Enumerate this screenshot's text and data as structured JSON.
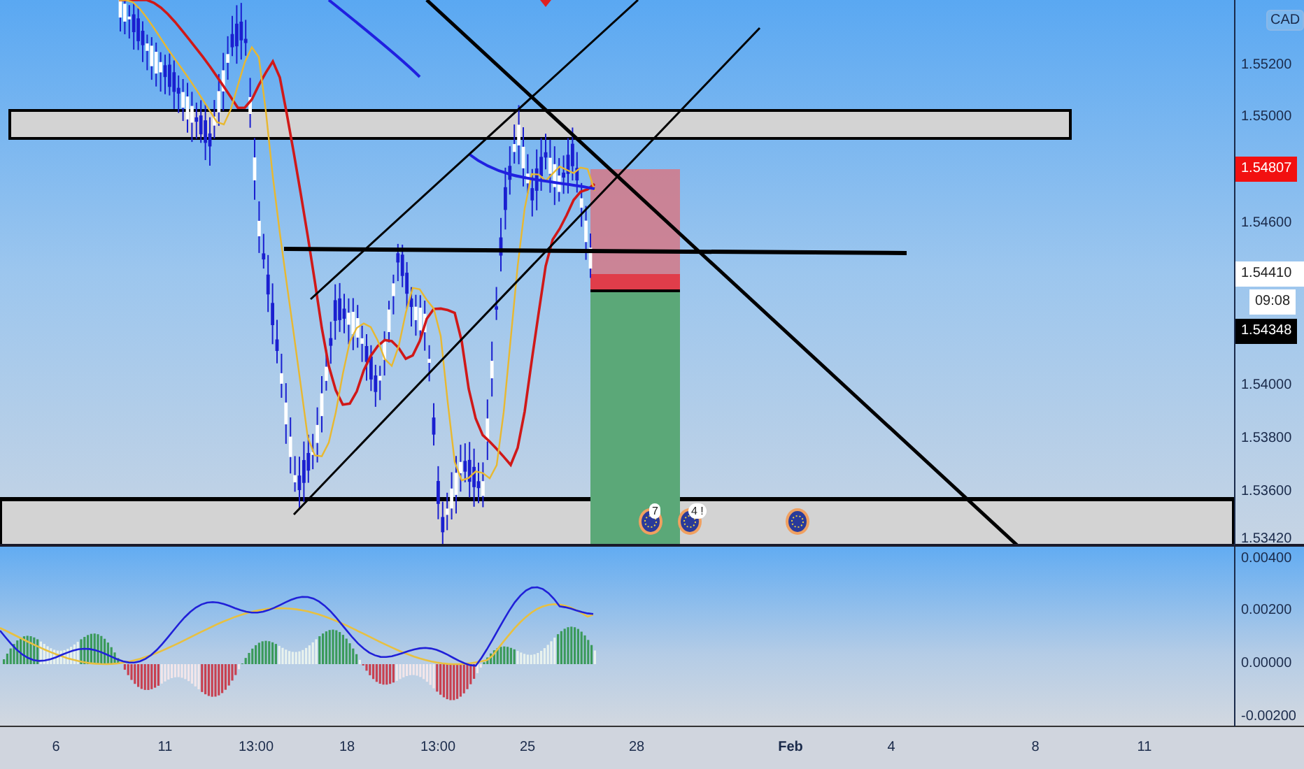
{
  "price_scale": {
    "currency": "CAD",
    "ticks": [
      "1.55200",
      "1.55000",
      "1.54600",
      "1.54000",
      "1.53800",
      "1.53600",
      "1.53420"
    ]
  },
  "price_labels": [
    {
      "kind": "alert",
      "text": "1.54807"
    },
    {
      "kind": "last",
      "text": "1.54410"
    },
    {
      "kind": "countdown",
      "text": "09:08"
    },
    {
      "kind": "cursor",
      "text": "1.54348"
    }
  ],
  "macd_scale": {
    "ticks": [
      "0.00400",
      "0.00200",
      "0.00000",
      "-0.00200"
    ]
  },
  "time_scale": {
    "ticks": [
      {
        "label": "6",
        "major": false
      },
      {
        "label": "11",
        "major": false
      },
      {
        "label": "13:00",
        "major": false
      },
      {
        "label": "18",
        "major": false
      },
      {
        "label": "13:00",
        "major": false
      },
      {
        "label": "25",
        "major": false
      },
      {
        "label": "28",
        "major": false
      },
      {
        "label": "Feb",
        "major": true
      },
      {
        "label": "4",
        "major": false
      },
      {
        "label": "8",
        "major": false
      },
      {
        "label": "11",
        "major": false
      }
    ]
  },
  "events": [
    {
      "kind": "flag",
      "badge": "7"
    },
    {
      "kind": "flag",
      "badge": "4 !"
    },
    {
      "kind": "flag"
    }
  ]
}
